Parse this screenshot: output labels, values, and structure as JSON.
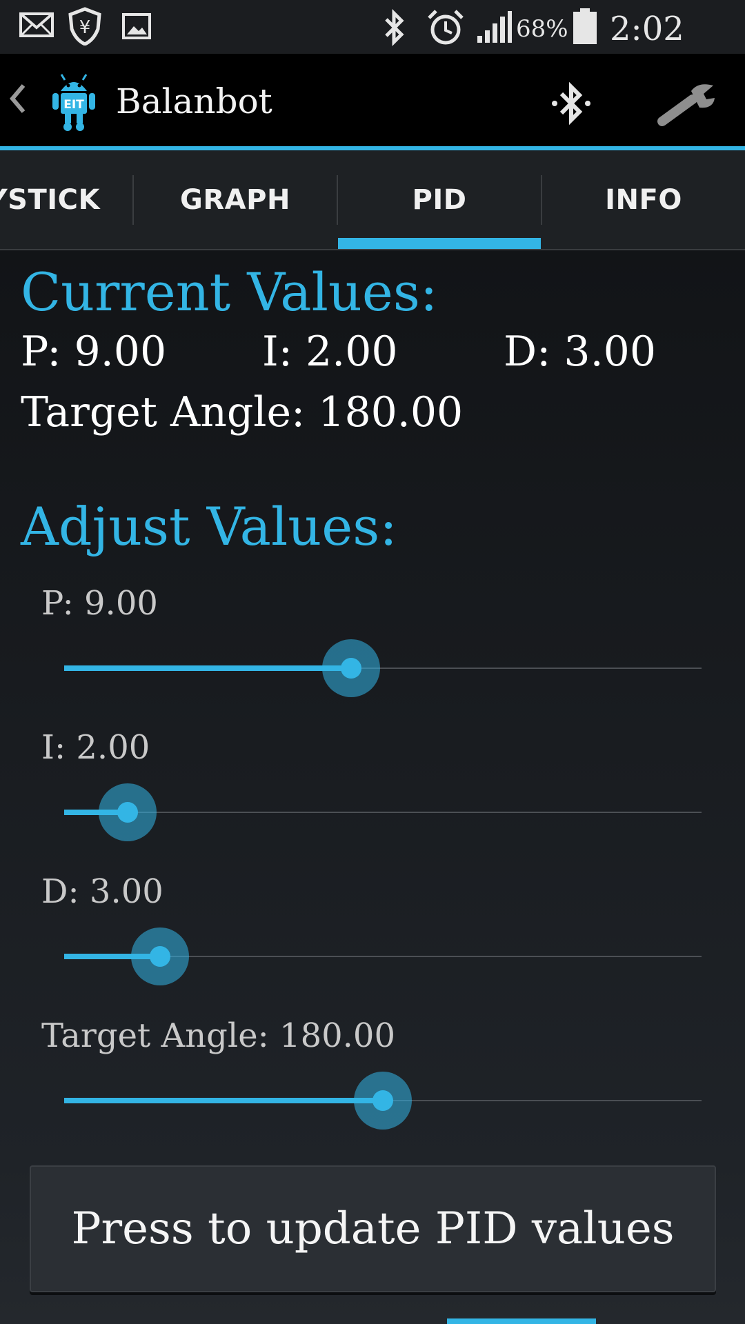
{
  "status_bar": {
    "icons": [
      "mail-icon",
      "shield-icon",
      "image-icon",
      "bluetooth-icon",
      "alarm-icon",
      "signal-icon",
      "battery-icon"
    ],
    "battery": "68%",
    "time": "2:02 PM"
  },
  "action_bar": {
    "title": "Balanbot",
    "logo_text": "EIT",
    "accent": "#33b5e5"
  },
  "tabs": [
    {
      "label": "YSTICK"
    },
    {
      "label": "GRAPH"
    },
    {
      "label": "PID",
      "selected": true
    },
    {
      "label": "INFO"
    }
  ],
  "current": {
    "heading": "Current Values:",
    "p": "P:  9.00",
    "i": "I:  2.00",
    "d": "D:  3.00",
    "target": "Target Angle:  180.00"
  },
  "adjust": {
    "heading": "Adjust Values:",
    "sliders": [
      {
        "label": "P: 9.00",
        "fraction": 0.45
      },
      {
        "label": "I: 2.00",
        "fraction": 0.1
      },
      {
        "label": "D: 3.00",
        "fraction": 0.15
      },
      {
        "label": "Target Angle: 180.00",
        "fraction": 0.5
      }
    ]
  },
  "update_button": {
    "label": "Press to update PID values"
  }
}
